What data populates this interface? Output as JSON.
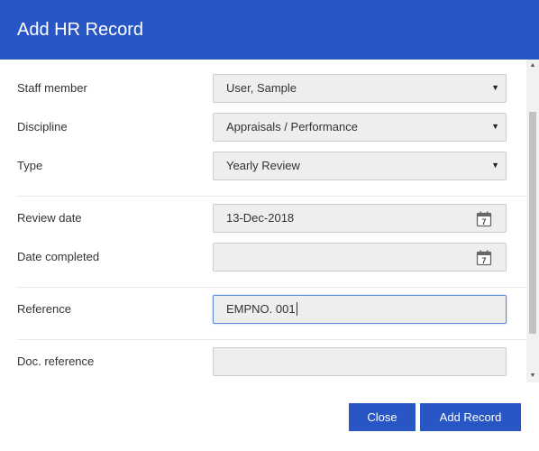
{
  "dialog": {
    "title": "Add HR Record"
  },
  "form": {
    "staff_member": {
      "label": "Staff member",
      "value": "User, Sample"
    },
    "discipline": {
      "label": "Discipline",
      "value": "Appraisals / Performance"
    },
    "type": {
      "label": "Type",
      "value": "Yearly Review"
    },
    "review_date": {
      "label": "Review date",
      "value": "13-Dec-2018"
    },
    "date_completed": {
      "label": "Date completed",
      "value": ""
    },
    "reference": {
      "label": "Reference",
      "value": "EMPNO. 001"
    },
    "doc_reference": {
      "label": "Doc. reference",
      "value": ""
    }
  },
  "icons": {
    "select_arrow": "▼",
    "calendar": "calendar-icon",
    "scroll_up": "▲",
    "scroll_down": "▼"
  },
  "calendar_day": "7",
  "buttons": {
    "close": "Close",
    "add_record": "Add Record"
  },
  "colors": {
    "accent": "#2857c5",
    "field_bg": "#eeeeee",
    "focus_border": "#5b8dd9"
  }
}
